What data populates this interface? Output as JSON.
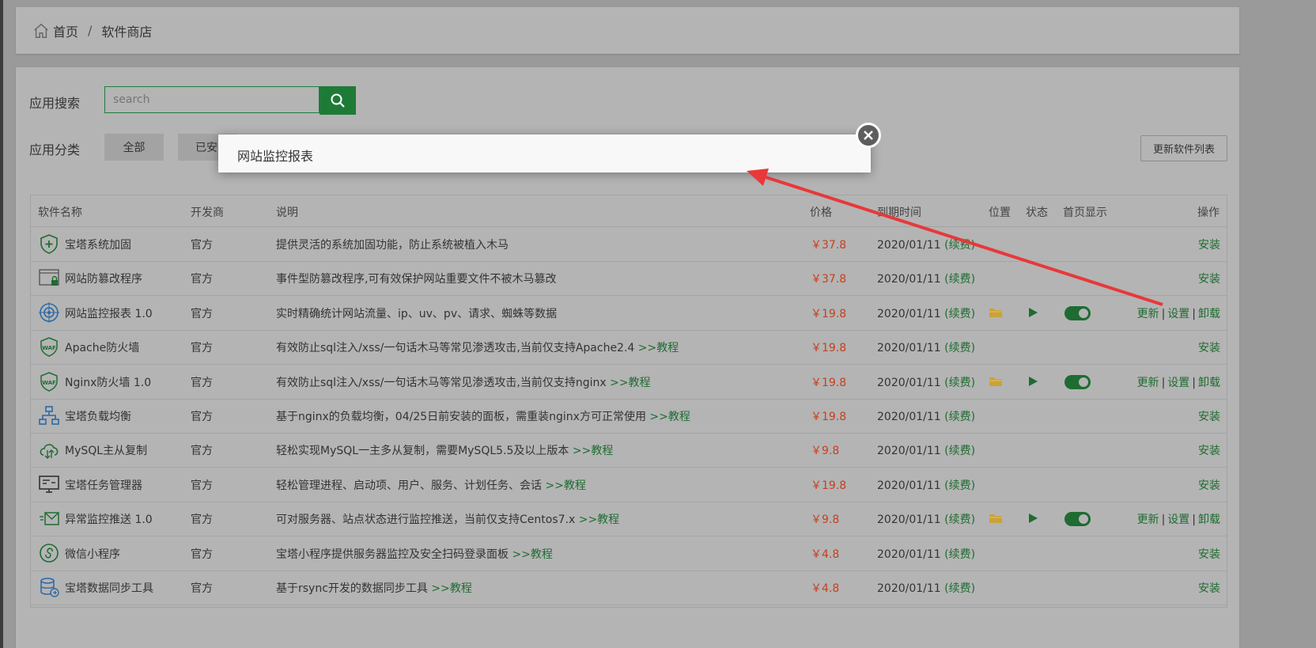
{
  "breadcrumb": {
    "home": "首页",
    "separator": "/",
    "current": "软件商店"
  },
  "search": {
    "label": "应用搜索",
    "placeholder": "search"
  },
  "category": {
    "label": "应用分类",
    "items": [
      {
        "label": "全部"
      },
      {
        "label": "已安"
      }
    ],
    "refresh_label": "更新软件列表"
  },
  "table": {
    "headers": {
      "name": "软件名称",
      "developer": "开发商",
      "description": "说明",
      "price": "价格",
      "expire": "到期时间",
      "position": "位置",
      "status": "状态",
      "homepage": "首页显示",
      "actions": "操作"
    },
    "rows": [
      {
        "icon": "shield-plus-icon",
        "name": "宝塔系统加固",
        "developer": "官方",
        "description": "提供灵活的系统加固功能，防止系统被植入木马",
        "tutorial": "",
        "price": "￥37.8",
        "expire": "2020/01/11",
        "renew": "(续费)",
        "action": "安装"
      },
      {
        "icon": "webpage-lock-icon",
        "name": "网站防篡改程序",
        "developer": "官方",
        "description": "事件型防篡改程序,可有效保护网站重要文件不被木马篡改",
        "tutorial": "",
        "price": "￥37.8",
        "expire": "2020/01/11",
        "renew": "(续费)",
        "action": "安装"
      },
      {
        "icon": "target-icon",
        "name": "网站监控报表 1.0",
        "developer": "官方",
        "description": "实时精确统计网站流量、ip、uv、pv、请求、蜘蛛等数据",
        "tutorial": "",
        "price": "￥19.8",
        "expire": "2020/01/11",
        "renew": "(续费)",
        "installed": true,
        "actions": [
          "更新",
          "设置",
          "卸载"
        ]
      },
      {
        "icon": "waf-shield-icon",
        "name": "Apache防火墙",
        "developer": "官方",
        "description": "有效防止sql注入/xss/一句话木马等常见渗透攻击,当前仅支持Apache2.4",
        "tutorial": ">>教程",
        "price": "￥19.8",
        "expire": "2020/01/11",
        "renew": "(续费)",
        "action": "安装"
      },
      {
        "icon": "waf-shield-icon",
        "name": "Nginx防火墙 1.0",
        "developer": "官方",
        "description": "有效防止sql注入/xss/一句话木马等常见渗透攻击,当前仅支持nginx",
        "tutorial": ">>教程",
        "price": "￥19.8",
        "expire": "2020/01/11",
        "renew": "(续费)",
        "installed": true,
        "actions": [
          "更新",
          "设置",
          "卸载"
        ]
      },
      {
        "icon": "network-icon",
        "name": "宝塔负载均衡",
        "developer": "官方",
        "description": "基于nginx的负载均衡，04/25日前安装的面板，需重装nginx方可正常使用",
        "tutorial": ">>教程",
        "price": "￥19.8",
        "expire": "2020/01/11",
        "renew": "(续费)",
        "action": "安装"
      },
      {
        "icon": "cloud-sync-icon",
        "name": "MySQL主从复制",
        "developer": "官方",
        "description": "轻松实现MySQL一主多从复制，需要MySQL5.5及以上版本",
        "tutorial": ">>教程",
        "price": "￥9.8",
        "expire": "2020/01/11",
        "renew": "(续费)",
        "action": "安装"
      },
      {
        "icon": "monitor-icon",
        "name": "宝塔任务管理器",
        "developer": "官方",
        "description": "轻松管理进程、启动项、用户、服务、计划任务、会话",
        "tutorial": ">>教程",
        "price": "￥19.8",
        "expire": "2020/01/11",
        "renew": "(续费)",
        "action": "安装"
      },
      {
        "icon": "send-mail-icon",
        "name": "异常监控推送 1.0",
        "developer": "官方",
        "description": "可对服务器、站点状态进行监控推送，当前仅支持Centos7.x",
        "tutorial": ">>教程",
        "price": "￥9.8",
        "expire": "2020/01/11",
        "renew": "(续费)",
        "installed": true,
        "actions": [
          "更新",
          "设置",
          "卸载"
        ]
      },
      {
        "icon": "mini-program-icon",
        "name": "微信小程序",
        "developer": "官方",
        "description": "宝塔小程序提供服务器监控及安全扫码登录面板",
        "tutorial": ">>教程",
        "price": "￥4.8",
        "expire": "2020/01/11",
        "renew": "(续费)",
        "action": "安装"
      },
      {
        "icon": "database-sync-icon",
        "name": "宝塔数据同步工具",
        "developer": "官方",
        "description": "基于rsync开发的数据同步工具",
        "tutorial": ">>教程",
        "price": "￥4.8",
        "expire": "2020/01/11",
        "renew": "(续费)",
        "action": "安装"
      }
    ]
  },
  "modal": {
    "title": "网站监控报表"
  },
  "colors": {
    "brand_green": "#1e7b37",
    "price_red": "#c5401d",
    "arrow_red": "#e8383a"
  }
}
